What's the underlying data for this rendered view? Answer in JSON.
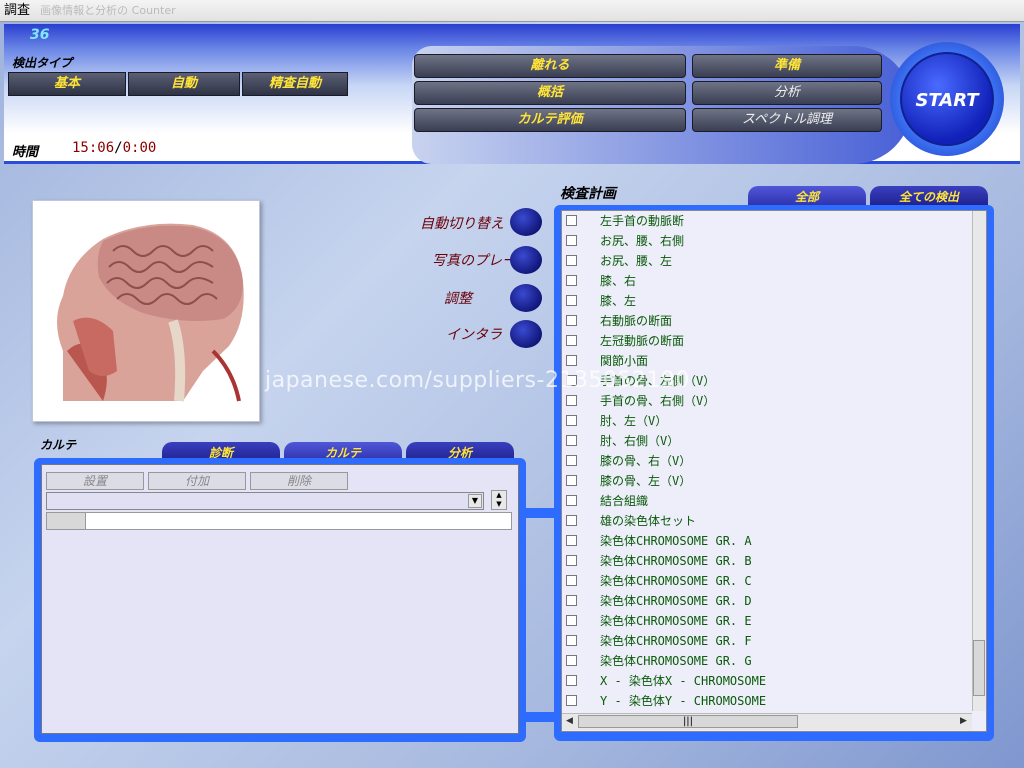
{
  "window": {
    "title": "調査",
    "title_ghost": "画像情報と分析の Counter"
  },
  "header": {
    "counter": "36",
    "type_label": "検出タイプ",
    "modes": [
      "基本",
      "自動",
      "精査自動"
    ],
    "time_label": "時間",
    "time_elapsed": "15:06",
    "time_remaining": "0:00",
    "tools_left": [
      "離れる",
      "概括",
      "カルテ評価"
    ],
    "tools_right": [
      "準備",
      "分析",
      "スペクトル調理"
    ],
    "start_label": "START"
  },
  "options": [
    "自動切り替え",
    "写真のプレー",
    "調整",
    "インタラ"
  ],
  "plan": {
    "title": "検査計画",
    "tabs": [
      "全部",
      "全ての検出"
    ],
    "items": [
      "左手首の動脈断",
      "お尻、腰、右側",
      "お尻、腰、左",
      "膝、右",
      "膝、左",
      "右動脈の断面",
      "左冠動脈の断面",
      "関節小面",
      "手首の骨、左側（V）",
      "手首の骨、右側（V）",
      "肘、左（V）",
      "肘、右側（V）",
      "膝の骨、右（V）",
      "膝の骨、左（V）",
      "結合組織",
      "雄の染色体セット",
      "染色体CHROMOSOME GR. A",
      "染色体CHROMOSOME GR. B",
      "染色体CHROMOSOME GR. C",
      "染色体CHROMOSOME GR. D",
      "染色体CHROMOSOME GR. E",
      "染色体CHROMOSOME GR. F",
      "染色体CHROMOSOME GR. G",
      "X - 染色体X - CHROMOSOME",
      "Y - 染色体Y - CHROMOSOME"
    ]
  },
  "karte": {
    "label": "カルテ",
    "tabs": [
      "診断",
      "カルテ",
      "分析"
    ],
    "buttons": [
      "設置",
      "付加",
      "削除"
    ]
  },
  "watermark": "japanese.com/suppliers-2135052190",
  "colors": {
    "accent_yellow": "#ffe437",
    "panel_blue": "#2d6cff",
    "time_red": "#8a0000"
  }
}
